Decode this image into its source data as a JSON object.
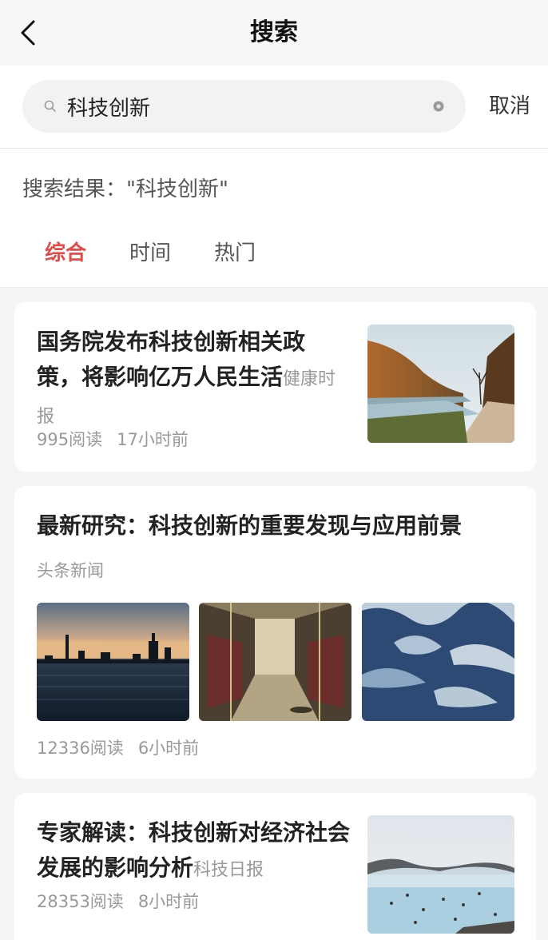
{
  "header": {
    "title": "搜索",
    "back_icon": "chevron-left-icon"
  },
  "search": {
    "value": "科技创新",
    "placeholder": "",
    "cancel_label": "取消",
    "search_icon": "search-icon",
    "clear_icon": "clear-icon"
  },
  "results": {
    "label": "搜索结果：\"科技创新\"",
    "tabs": [
      {
        "label": "综合",
        "active": true
      },
      {
        "label": "时间",
        "active": false
      },
      {
        "label": "热门",
        "active": false
      }
    ]
  },
  "articles": [
    {
      "title": "国务院发布科技创新相关政策，将影响亿万人民生活",
      "source": "健康时报",
      "reads": "995阅读",
      "time": "17小时前",
      "image_subject": "autumn valley river road"
    },
    {
      "title": "最新研究：科技创新的重要发现与应用前景",
      "source": "头条新闻",
      "reads": "12336阅读",
      "time": "6小时前",
      "image_subjects": [
        "city skyline at dusk over water",
        "empty bus interior",
        "blue water waves"
      ]
    },
    {
      "title": "专家解读：科技创新对经济社会发展的影响分析",
      "source": "科技日报",
      "reads": "28353阅读",
      "time": "8小时前",
      "image_subject": "geothermal hot spring lagoon"
    }
  ],
  "colors": {
    "accent": "#e34b48",
    "muted": "#999999",
    "page_bg": "#f5f5f5"
  }
}
